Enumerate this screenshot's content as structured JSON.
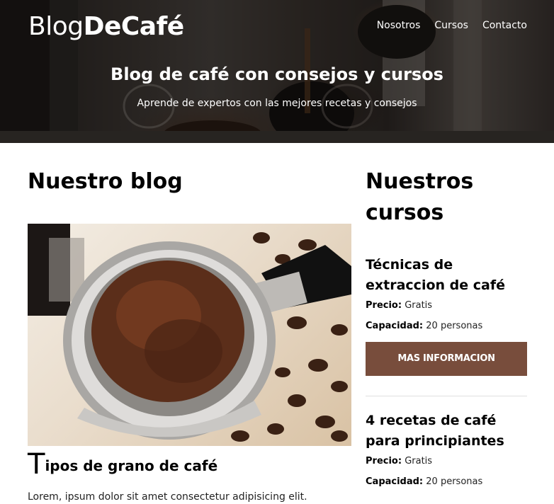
{
  "header": {
    "logo": {
      "light": "Blog",
      "bold": "DeCafé"
    },
    "nav": [
      {
        "label": "Nosotros"
      },
      {
        "label": "Cursos"
      },
      {
        "label": "Contacto"
      }
    ],
    "title": "Blog de café con consejos y cursos",
    "subtitle": "Aprende de expertos con las mejores recetas y consejos"
  },
  "blog": {
    "heading": "Nuestro blog",
    "entry": {
      "image_alt": "portafiltro con café molido",
      "title_initial": "T",
      "title_rest": "ipos de grano de café",
      "excerpt": "Lorem, ipsum dolor sit amet consectetur adipisicing elit."
    }
  },
  "courses": {
    "heading_line1": "Nuestros",
    "heading_line2": "cursos",
    "items": [
      {
        "title": "Técnicas de extraccion de café",
        "price_label": "Precio:",
        "price": "Gratis",
        "capacity_label": "Capacidad:",
        "capacity": "20 personas",
        "button": "MAS INFORMACION"
      },
      {
        "title": "4 recetas de café para principiantes",
        "price_label": "Precio:",
        "price": "Gratis",
        "capacity_label": "Capacidad:",
        "capacity": "20 personas"
      }
    ]
  },
  "colors": {
    "accent": "#784d3c",
    "hero_overlay": "#000000"
  }
}
